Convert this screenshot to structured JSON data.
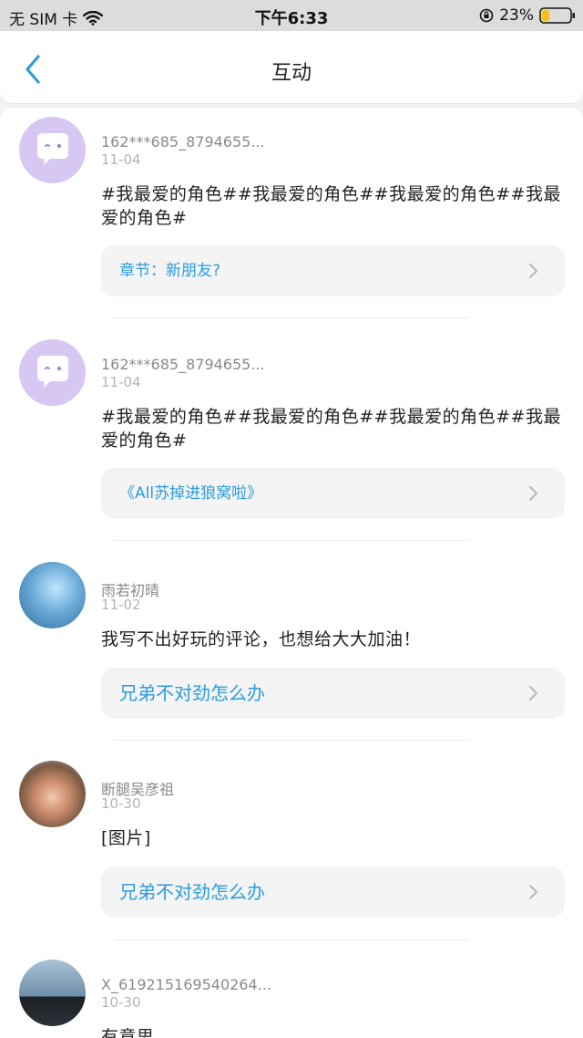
{
  "status_bar": {
    "carrier": "无 SIM 卡",
    "time": "下午6:33",
    "battery": "23%"
  },
  "header": {
    "title": "互动"
  },
  "items": [
    {
      "username": "162***685_8794655...",
      "date": "11-04",
      "content": "#我最爱的角色##我最爱的角色##我最爱的角色##我最爱的角色#",
      "link": "章节：新朋友?",
      "avatar_type": "default"
    },
    {
      "username": "162***685_8794655...",
      "date": "11-04",
      "content": "#我最爱的角色##我最爱的角色##我最爱的角色##我最爱的角色#",
      "link": "《All苏掉进狼窝啦》",
      "avatar_type": "default"
    },
    {
      "username": "雨若初晴",
      "date": "11-02",
      "content": "我写不出好玩的评论，也想给大大加油！",
      "link": "兄弟不对劲怎么办",
      "avatar_type": "photo"
    },
    {
      "username": "断腿吴彦祖",
      "date": "10-30",
      "content": "[图片]",
      "link": "兄弟不对劲怎么办",
      "avatar_type": "photo"
    },
    {
      "username": "X_619215169540264...",
      "date": "10-30",
      "content": "有意思",
      "avatar_type": "photo"
    }
  ],
  "colors": {
    "accent": "#2d9bdc",
    "default_avatar": "#d7c8f3"
  }
}
